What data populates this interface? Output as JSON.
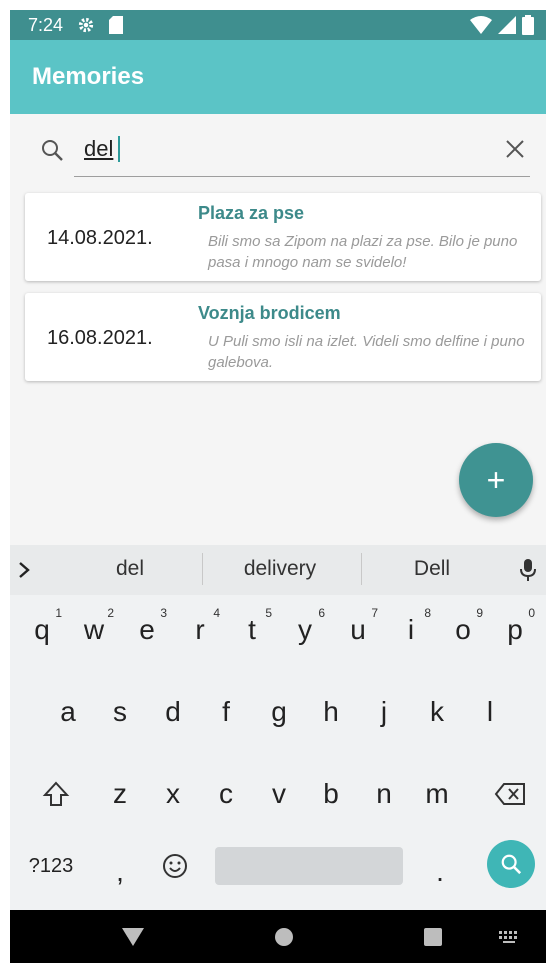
{
  "status_bar": {
    "time": "7:24"
  },
  "app": {
    "title": "Memories"
  },
  "search": {
    "value": "del",
    "placeholder": ""
  },
  "memories": [
    {
      "date": "14.08.2021.",
      "title": "Plaza za pse",
      "text": "Bili smo sa Zipom na plazi za pse. Bilo je puno pasa i mnogo nam se svidelo!"
    },
    {
      "date": "16.08.2021.",
      "title": "Voznja brodicem",
      "text": "U Puli smo isli na izlet. Videli smo delfine i puno galebova."
    }
  ],
  "fab": {
    "label": "+"
  },
  "keyboard": {
    "suggestions": [
      "del",
      "delivery",
      "Dell"
    ],
    "row1": [
      {
        "k": "q",
        "h": "1"
      },
      {
        "k": "w",
        "h": "2"
      },
      {
        "k": "e",
        "h": "3"
      },
      {
        "k": "r",
        "h": "4"
      },
      {
        "k": "t",
        "h": "5"
      },
      {
        "k": "y",
        "h": "6"
      },
      {
        "k": "u",
        "h": "7"
      },
      {
        "k": "i",
        "h": "8"
      },
      {
        "k": "o",
        "h": "9"
      },
      {
        "k": "p",
        "h": "0"
      }
    ],
    "row2": [
      "a",
      "s",
      "d",
      "f",
      "g",
      "h",
      "j",
      "k",
      "l"
    ],
    "row3": [
      "z",
      "x",
      "c",
      "v",
      "b",
      "n",
      "m"
    ],
    "symbols_label": "?123",
    "comma_label": ",",
    "period_label": "."
  },
  "colors": {
    "app_bar": "#5bc4c6",
    "status_bar": "#3f8f8f",
    "accent": "#3f9392",
    "title_text": "#3d8a8a"
  }
}
